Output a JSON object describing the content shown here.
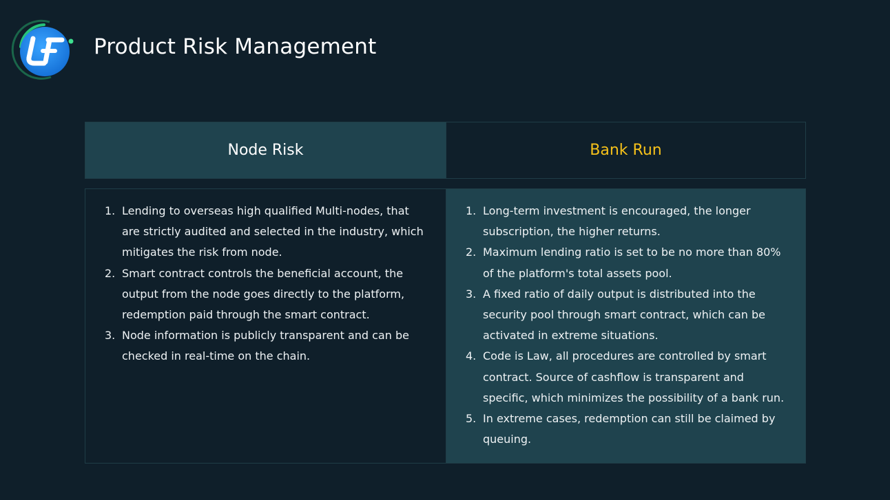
{
  "header": {
    "logo_text": "LF",
    "title": "Product Risk Management"
  },
  "tabs": [
    {
      "label": "Node Risk"
    },
    {
      "label": "Bank Run"
    }
  ],
  "node_risk": {
    "items": [
      {
        "num": "1.",
        "text": "Lending to overseas high qualified Multi-nodes, that are strictly audited and selected in the industry, which mitigates the risk from node."
      },
      {
        "num": "2.",
        "text": "Smart contract controls the beneficial account, the output from the node goes directly to the platform, redemption paid through the smart contract."
      },
      {
        "num": "3.",
        "text": "Node information is publicly transparent and can be checked in real-time on the chain."
      }
    ]
  },
  "bank_run": {
    "items": [
      {
        "num": "1.",
        "text": "Long-term investment is encouraged, the longer subscription, the higher returns."
      },
      {
        "num": "2.",
        "text": "Maximum lending ratio is set to be no more than 80% of the platform's total assets pool."
      },
      {
        "num": "3.",
        "text": "A fixed ratio of daily output is distributed into the security pool through smart contract, which can be activated in extreme situations."
      },
      {
        "num": "4.",
        "text": "Code is Law, all procedures are controlled by smart contract. Source of cashflow is transparent and specific, which minimizes the possibility of a bank run."
      },
      {
        "num": "5.",
        "text": "In extreme cases, redemption can still be claimed by queuing."
      }
    ]
  },
  "colors": {
    "background": "#0f1f2a",
    "panel_teal": "#1f434e",
    "accent_yellow": "#f6c11a",
    "logo_blue": "#1b87e6",
    "logo_green": "#27c27a"
  }
}
